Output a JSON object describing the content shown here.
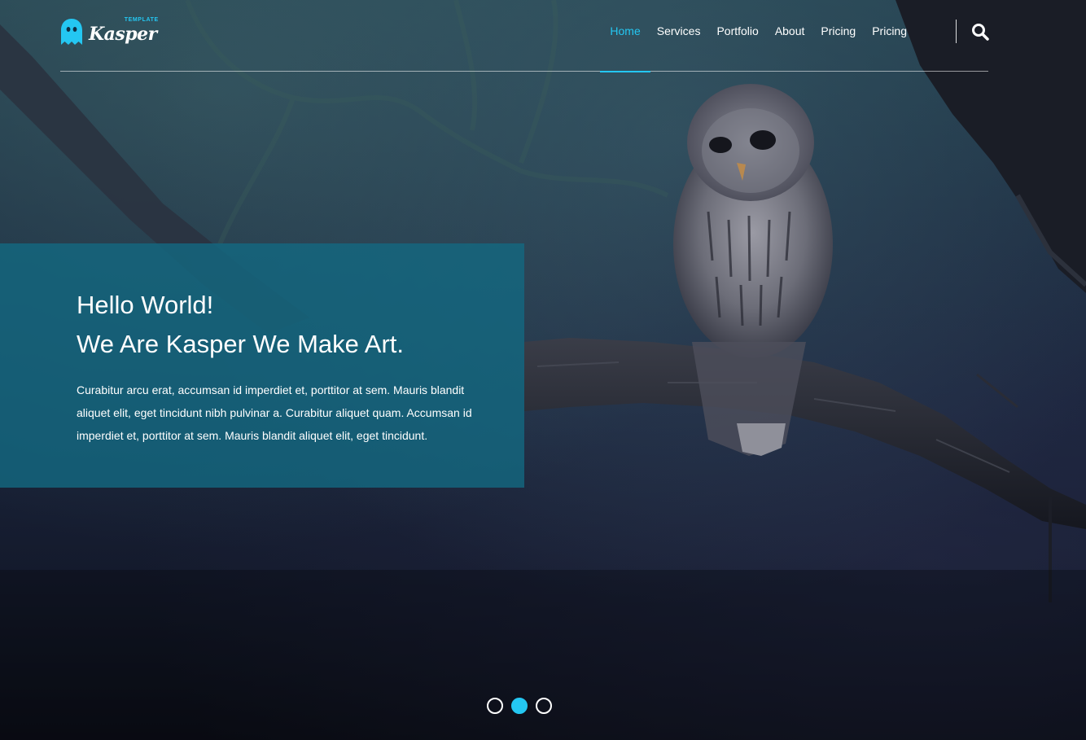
{
  "brand": {
    "logo_text": "Kasper",
    "logo_subtext": "TEMPLATE",
    "logo_icon": "ghost-icon",
    "accent_color": "#24c7f2"
  },
  "nav": {
    "items": [
      {
        "label": "Home",
        "active": true
      },
      {
        "label": "Services",
        "active": false
      },
      {
        "label": "Portfolio",
        "active": false
      },
      {
        "label": "About",
        "active": false
      },
      {
        "label": "Pricing",
        "active": false
      },
      {
        "label": "Pricing",
        "active": false
      }
    ],
    "search_icon": "search-icon"
  },
  "hero": {
    "title_line1": "Hello World!",
    "title_line2": "We Are Kasper We Make Art.",
    "description": "Curabitur arcu erat, accumsan id imperdiet et, porttitor at sem. Mauris blandit aliquet elit, eget tincidunt nibh pulvinar a. Curabitur aliquet quam. Accumsan id imperdiet et, porttitor at sem. Mauris blandit aliquet elit, eget tincidunt.",
    "box_color": "#136880",
    "slider": {
      "count": 3,
      "active_index": 1
    }
  }
}
